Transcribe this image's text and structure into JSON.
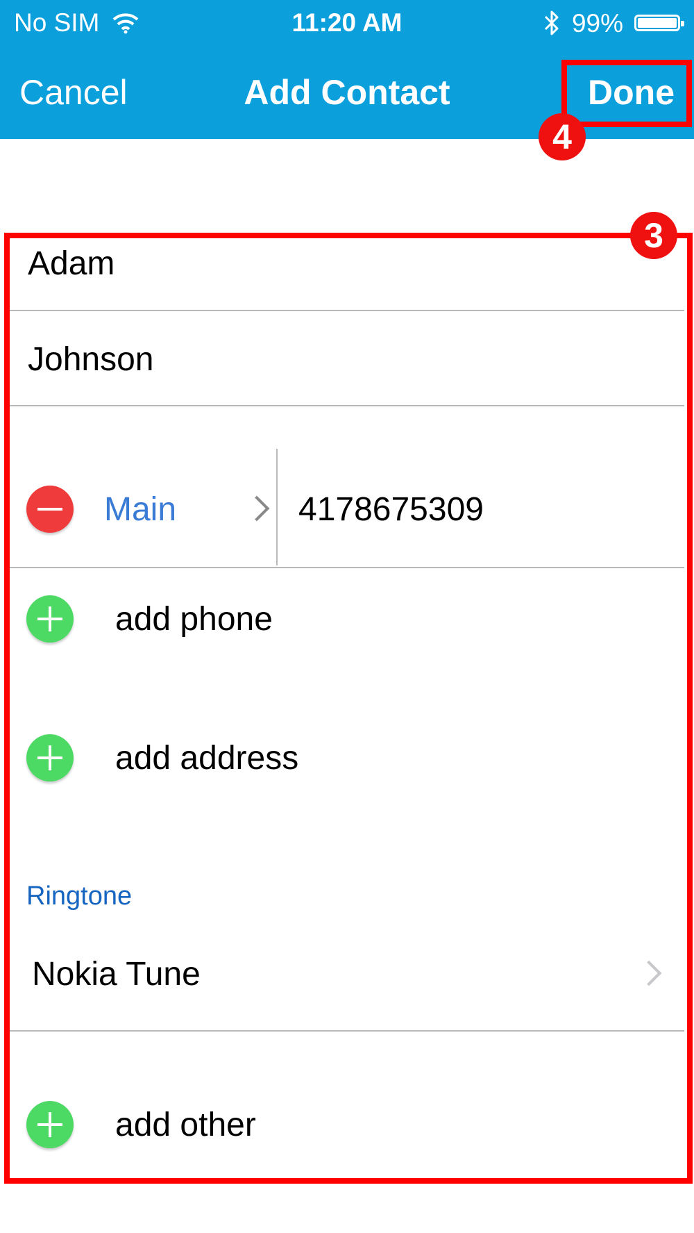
{
  "status_bar": {
    "carrier": "No SIM",
    "time": "11:20 AM",
    "battery": "99%"
  },
  "nav": {
    "cancel": "Cancel",
    "title": "Add Contact",
    "done": "Done"
  },
  "form": {
    "first_name": "Adam",
    "last_name": "Johnson",
    "phone": {
      "label": "Main",
      "number": "4178675309"
    },
    "add_phone": "add phone",
    "add_address": "add address",
    "ringtone": {
      "header": "Ringtone",
      "value": "Nokia Tune"
    },
    "add_other": "add other"
  },
  "annotations": [
    "3",
    "4"
  ],
  "colors": {
    "header_bg": "#0b9fdc",
    "highlight": "#ff0000",
    "link_blue": "#3a7bd5",
    "remove_red": "#ef3b3b",
    "add_green": "#4cd964"
  }
}
